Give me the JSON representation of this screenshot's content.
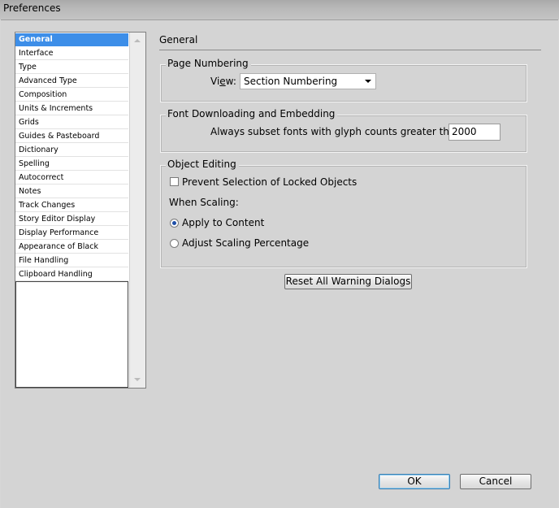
{
  "window": {
    "title": "Preferences"
  },
  "sidebar": {
    "items": [
      {
        "label": "General",
        "selected": true
      },
      {
        "label": "Interface"
      },
      {
        "label": "Type"
      },
      {
        "label": "Advanced Type"
      },
      {
        "label": "Composition"
      },
      {
        "label": "Units & Increments"
      },
      {
        "label": "Grids"
      },
      {
        "label": "Guides & Pasteboard"
      },
      {
        "label": "Dictionary"
      },
      {
        "label": "Spelling"
      },
      {
        "label": "Autocorrect"
      },
      {
        "label": "Notes"
      },
      {
        "label": "Track Changes"
      },
      {
        "label": "Story Editor Display"
      },
      {
        "label": "Display Performance"
      },
      {
        "label": "Appearance of Black"
      },
      {
        "label": "File Handling"
      },
      {
        "label": "Clipboard Handling"
      }
    ]
  },
  "main": {
    "title": "General",
    "page_numbering": {
      "group_label": "Page Numbering",
      "view_label_prefix": "Vi",
      "view_label_mnemonic": "e",
      "view_label_suffix": "w:",
      "view_value": "Section Numbering"
    },
    "font_downloading": {
      "group_label": "Font Downloading and Embedding",
      "subset_label": "Always subset fonts with glyph counts greater than:",
      "subset_value": "2000"
    },
    "object_editing": {
      "group_label": "Object Editing",
      "prevent_selection_label": "Prevent Selection of Locked Objects",
      "prevent_selection_checked": false,
      "when_scaling_label": "When Scaling:",
      "apply_to_content_label": "Apply to Content",
      "apply_to_content_selected": true,
      "adjust_scaling_label": "Adjust Scaling Percentage",
      "adjust_scaling_selected": false
    },
    "reset_warnings_label": "Reset All Warning Dialogs"
  },
  "footer": {
    "ok_label": "OK",
    "cancel_label": "Cancel"
  },
  "colors": {
    "selection": "#3d8ee8",
    "background": "#d4d4d4"
  }
}
